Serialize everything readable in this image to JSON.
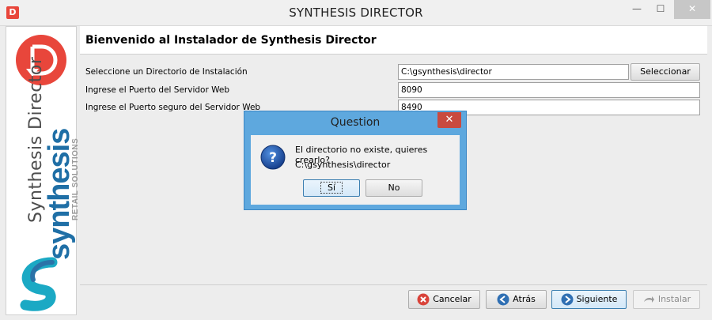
{
  "window": {
    "title": "SYNTHESIS DIRECTOR",
    "min_glyph": "—",
    "max_glyph": "☐",
    "close_glyph": "✕"
  },
  "branding": {
    "vertical_text": "Synthesis Director",
    "brand_name": "synthesis",
    "brand_tagline": "RETAIL SOLUTIONS",
    "accent_red": "#e8463b",
    "accent_blue": "#1f6fa6"
  },
  "header": {
    "title": "Bienvenido al Instalador de Synthesis Director"
  },
  "form": {
    "directory": {
      "label": "Seleccione un Directorio de Instalación",
      "value": "C:\\gsynthesis\\director",
      "button_label": "Seleccionar"
    },
    "port": {
      "label": "Ingrese el Puerto del Servidor Web",
      "value": "8090"
    },
    "secure_port": {
      "label": "Ingrese el Puerto seguro del Servidor Web",
      "value": "8490"
    }
  },
  "footer": {
    "cancel_label": "Cancelar",
    "back_label": "Atrás",
    "next_label": "Siguiente",
    "install_label": "Instalar"
  },
  "dialog": {
    "title": "Question",
    "message": "El directorio no existe, quieres crearlo?",
    "path": "C:\\gsynthesis\\director",
    "yes_label": "Sí",
    "no_label": "No",
    "close_glyph": "✕"
  }
}
